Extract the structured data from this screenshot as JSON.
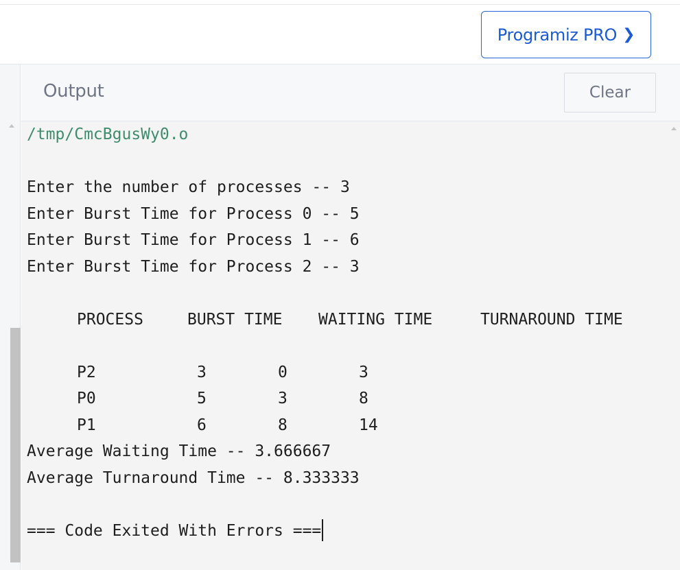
{
  "header": {
    "pro_button": "Programiz PRO",
    "pro_chevron": "❯"
  },
  "output": {
    "title": "Output",
    "clear_label": "Clear"
  },
  "console": {
    "path": "/tmp/CmcBgusWy0.o",
    "prompts": [
      "Enter the number of processes -- 3",
      "Enter Burst Time for Process 0 -- 5",
      "Enter Burst Time for Process 1 -- 6",
      "Enter Burst Time for Process 2 -- 3"
    ],
    "table_headers": [
      "PROCESS",
      "BURST TIME",
      "WAITING TIME",
      "TURNAROUND TIME"
    ],
    "rows": [
      [
        "P2",
        "3",
        "0",
        "3"
      ],
      [
        "P0",
        "5",
        "3",
        "8"
      ],
      [
        "P1",
        "6",
        "8",
        "14"
      ]
    ],
    "avg_waiting": "Average Waiting Time -- 3.666667",
    "avg_turnaround": "Average Turnaround Time -- 8.333333",
    "exit_message": "=== Code Exited With Errors ==="
  }
}
